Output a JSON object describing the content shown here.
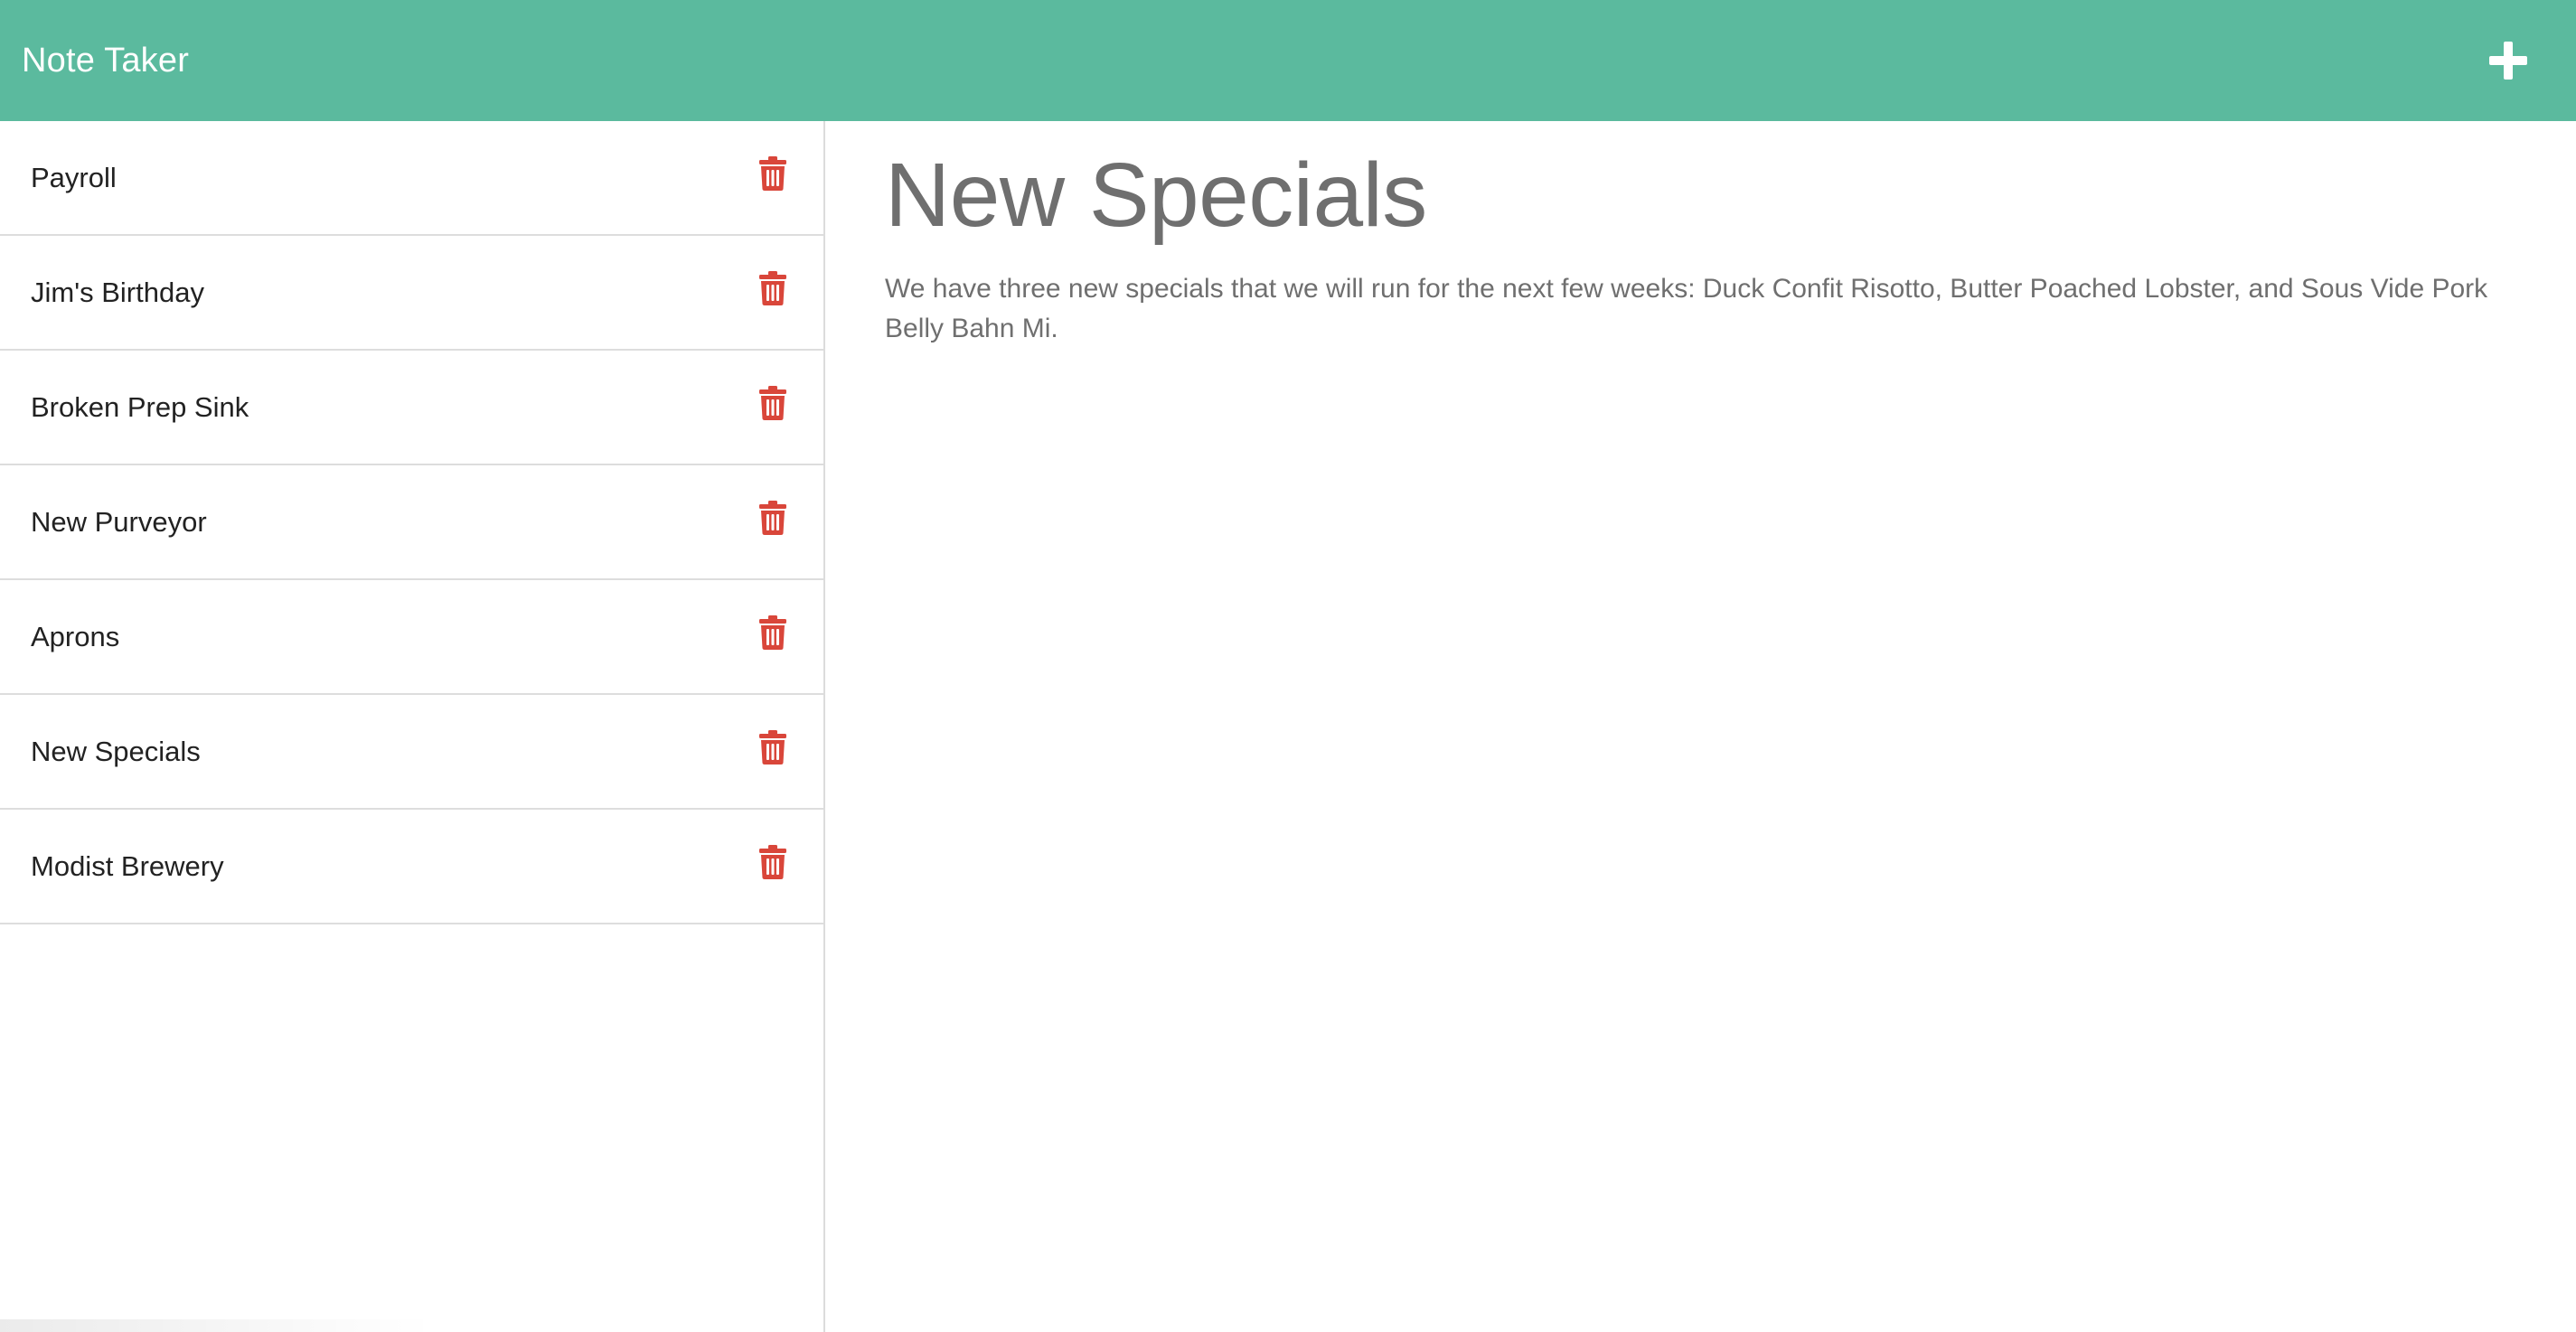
{
  "navbar": {
    "title": "Note Taker",
    "background": "#5bba9e",
    "add_icon": "plus-icon"
  },
  "sidebar": {
    "delete_icon": "trash-icon",
    "delete_color": "#d9463a",
    "notes": [
      {
        "title": "Payroll"
      },
      {
        "title": "Jim's Birthday"
      },
      {
        "title": "Broken Prep Sink"
      },
      {
        "title": "New Purveyor"
      },
      {
        "title": "Aprons"
      },
      {
        "title": "New Specials"
      },
      {
        "title": "Modist Brewery"
      }
    ]
  },
  "main": {
    "note_title": "New Specials",
    "note_text": "We have three new specials that we will run for the next few weeks: Duck Confit Risotto, Butter Poached Lobster, and Sous Vide Pork Belly Bahn Mi."
  }
}
